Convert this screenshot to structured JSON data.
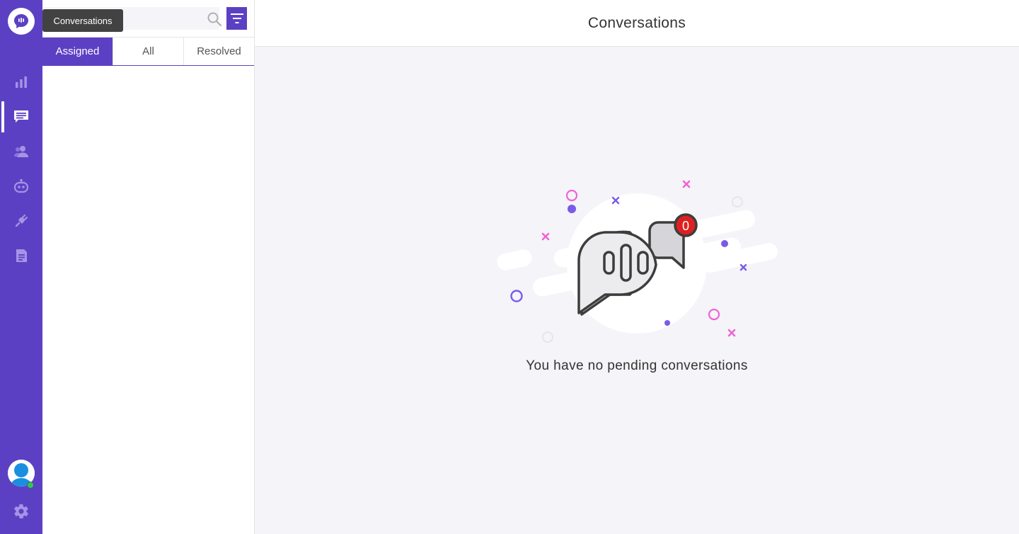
{
  "tooltip": {
    "text": "Conversations"
  },
  "rail": {
    "logo_icon": "chat-logo-icon",
    "nav": [
      {
        "name": "reports",
        "icon": "bar-chart-icon"
      },
      {
        "name": "conversations",
        "icon": "message-list-icon",
        "active": true
      },
      {
        "name": "contacts",
        "icon": "contacts-icon"
      },
      {
        "name": "bot",
        "icon": "bot-icon"
      },
      {
        "name": "integrations",
        "icon": "plug-icon"
      },
      {
        "name": "knowledge-base",
        "icon": "document-icon"
      }
    ],
    "presence_color": "#2ecc40"
  },
  "search": {
    "placeholder": "",
    "value": ""
  },
  "tabs": [
    {
      "label": "Assigned",
      "active": true
    },
    {
      "label": "All",
      "active": false
    },
    {
      "label": "Resolved",
      "active": false
    }
  ],
  "main": {
    "title": "Conversations",
    "empty_message": "You have no pending conversations",
    "badge_count": "0"
  },
  "colors": {
    "accent": "#5c40c4",
    "badge": "#e02020",
    "pink": "#f064d4",
    "purple": "#7a5ae8"
  }
}
